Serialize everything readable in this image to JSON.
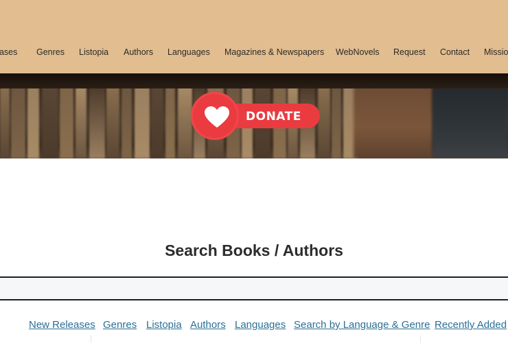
{
  "top_nav": {
    "items": [
      "eases",
      "Genres",
      "Listopia",
      "Authors",
      "Languages",
      "Magazines & Newspapers",
      "WebNovels",
      "Request",
      "Contact",
      "Missio"
    ]
  },
  "banner": {
    "donate_label": "DONATE",
    "donate_icon": "heart-icon"
  },
  "search": {
    "title": "Search Books / Authors",
    "value": "",
    "placeholder": ""
  },
  "quick_links": [
    "New Releases",
    "Genres",
    "Listopia",
    "Authors",
    "Languages",
    "Search by Language & Genre",
    "Recently Added"
  ],
  "colors": {
    "nav_bar": "#e2bd8f",
    "donate_red": "#ea3b40",
    "link_blue": "#2a6f95"
  }
}
